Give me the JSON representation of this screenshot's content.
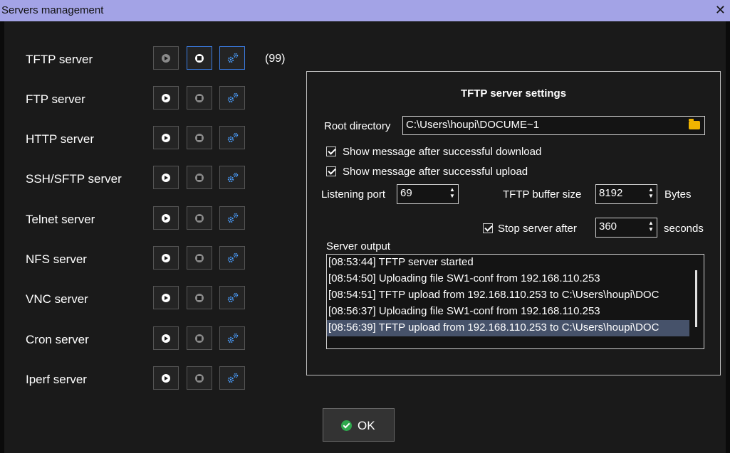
{
  "window": {
    "title": "Servers management",
    "close_label": "✕"
  },
  "servers": [
    {
      "name": "TFTP server",
      "running": true
    },
    {
      "name": "FTP server",
      "running": false
    },
    {
      "name": "HTTP server",
      "running": false
    },
    {
      "name": "SSH/SFTP server",
      "running": false
    },
    {
      "name": "Telnet server",
      "running": false
    },
    {
      "name": "NFS server",
      "running": false
    },
    {
      "name": "VNC server",
      "running": false
    },
    {
      "name": "Cron server",
      "running": false
    },
    {
      "name": "Iperf server",
      "running": false
    }
  ],
  "tftp_count": "(99)",
  "settings": {
    "title": "TFTP server settings",
    "root_dir_label": "Root directory",
    "root_dir_value": "C:\\Users\\houpi\\DOCUME~1",
    "show_download_label": "Show message after successful download",
    "show_upload_label": "Show message after successful upload",
    "listening_port_label": "Listening port",
    "listening_port_value": "69",
    "buffer_label": "TFTP buffer size",
    "buffer_value": "8192",
    "buffer_unit": "Bytes",
    "stop_after_label": "Stop server after",
    "stop_after_value": "360",
    "stop_after_unit": "seconds",
    "output_label": "Server output",
    "output_lines": [
      "[08:53:44] TFTP server started",
      "[08:54:50] Uploading file SW1-conf from 192.168.110.253",
      "[08:54:51] TFTP upload from 192.168.110.253 to C:\\Users\\houpi\\DOC",
      "[08:56:37] Uploading file SW1-conf from 192.168.110.253",
      "[08:56:39] TFTP upload from 192.168.110.253 to C:\\Users\\houpi\\DOC"
    ]
  },
  "ok_label": "OK",
  "colors": {
    "accent": "#3b7be0",
    "titlebar": "#a3a3e6",
    "ok_icon": "#2ea84d",
    "folder": "#f0b400"
  }
}
